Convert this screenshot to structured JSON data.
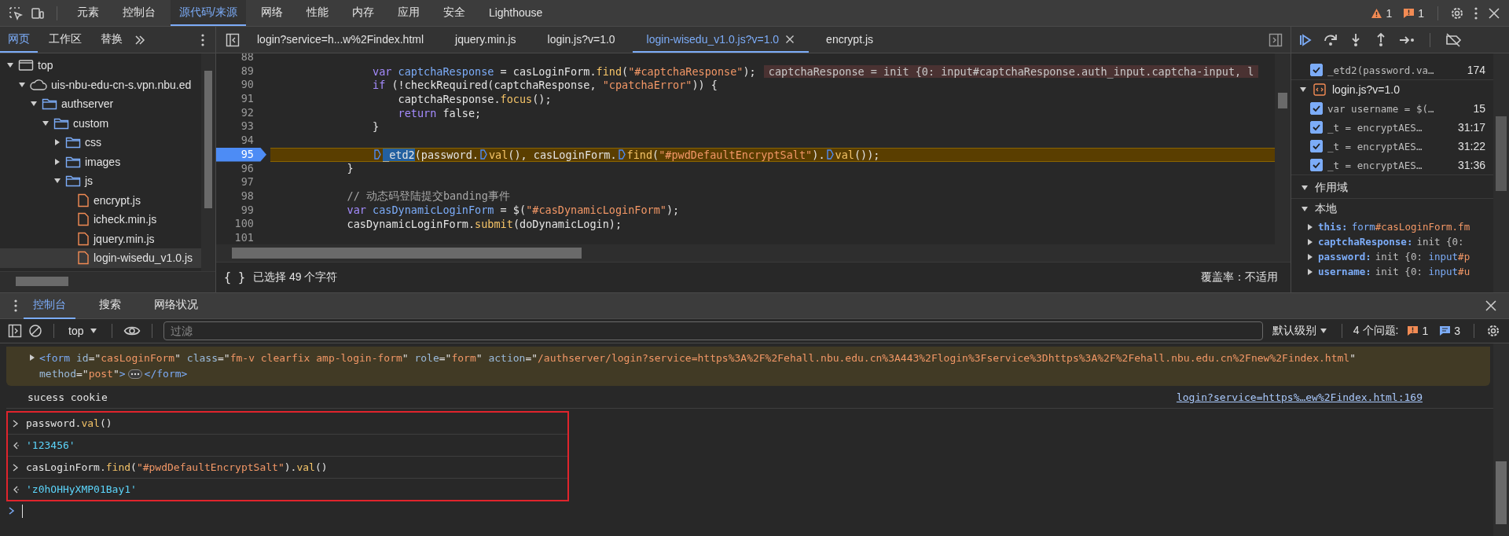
{
  "toolbar": {
    "tabs": [
      {
        "label": "元素",
        "selected": false
      },
      {
        "label": "控制台",
        "selected": false
      },
      {
        "label": "源代码/来源",
        "selected": true
      },
      {
        "label": "网络",
        "selected": false
      },
      {
        "label": "性能",
        "selected": false
      },
      {
        "label": "内存",
        "selected": false
      },
      {
        "label": "应用",
        "selected": false
      },
      {
        "label": "安全",
        "selected": false
      },
      {
        "label": "Lighthouse",
        "selected": false
      }
    ],
    "warnings": "1",
    "issues": "1"
  },
  "navigator": {
    "tabs": [
      {
        "label": "网页",
        "selected": true
      },
      {
        "label": "工作区",
        "selected": false
      },
      {
        "label": "替换",
        "selected": false
      }
    ],
    "tree": [
      {
        "label": "top",
        "kind": "frame",
        "expanded": true,
        "selected": false,
        "children": [
          {
            "label": "uis-nbu-edu-cn-s.vpn.nbu.ed",
            "kind": "domain",
            "expanded": true,
            "selected": false,
            "children": [
              {
                "label": "authserver",
                "kind": "folder",
                "expanded": true,
                "selected": false,
                "children": [
                  {
                    "label": "custom",
                    "kind": "folder",
                    "expanded": true,
                    "selected": false,
                    "children": [
                      {
                        "label": "css",
                        "kind": "folder",
                        "expanded": false,
                        "selected": false
                      },
                      {
                        "label": "images",
                        "kind": "folder",
                        "expanded": false,
                        "selected": false
                      },
                      {
                        "label": "js",
                        "kind": "folder",
                        "expanded": true,
                        "selected": false,
                        "children": [
                          {
                            "label": "encrypt.js",
                            "kind": "file",
                            "selected": false
                          },
                          {
                            "label": "icheck.min.js",
                            "kind": "file",
                            "selected": false
                          },
                          {
                            "label": "jquery.min.js",
                            "kind": "file",
                            "selected": false
                          },
                          {
                            "label": "login-wisedu_v1.0.js",
                            "kind": "file",
                            "selected": true
                          }
                        ]
                      }
                    ]
                  }
                ]
              }
            ]
          }
        ]
      }
    ]
  },
  "editor": {
    "tabs": [
      {
        "label": "login?service=h...w%2Findex.html",
        "selected": false
      },
      {
        "label": "jquery.min.js",
        "selected": false
      },
      {
        "label": "login.js?v=1.0",
        "selected": false
      },
      {
        "label": "login-wisedu_v1.0.js?v=1.0",
        "selected": true
      },
      {
        "label": "encrypt.js",
        "selected": false
      }
    ],
    "lines": [
      {
        "number": "88",
        "paused": false
      },
      {
        "number": "89",
        "paused": false,
        "tokens": [
          {
            "text": "var ",
            "kind": "keyword"
          },
          {
            "text": "captchaResponse",
            "kind": "def"
          },
          {
            "text": " = casLoginForm.",
            "kind": "plain"
          },
          {
            "text": "find",
            "kind": "method"
          },
          {
            "text": "(",
            "kind": "plain"
          },
          {
            "text": "\"#captchaResponse\"",
            "kind": "string"
          },
          {
            "text": ");",
            "kind": "plain"
          }
        ],
        "inline_value": "captchaResponse = init {0: input#captchaResponse.auth_input.captcha-input, l"
      },
      {
        "number": "90",
        "paused": false,
        "tokens": [
          {
            "text": "if",
            "kind": "keyword"
          },
          {
            "text": " (!checkRequired(captchaResponse, ",
            "kind": "plain"
          },
          {
            "text": "\"cpatchaError\"",
            "kind": "string"
          },
          {
            "text": ")) {",
            "kind": "plain"
          }
        ]
      },
      {
        "number": "91",
        "paused": false,
        "tokens": [
          {
            "text": "captchaResponse.",
            "kind": "plain"
          },
          {
            "text": "focus",
            "kind": "method"
          },
          {
            "text": "();",
            "kind": "plain"
          }
        ]
      },
      {
        "number": "92",
        "paused": false,
        "tokens": [
          {
            "text": "return",
            "kind": "keyword"
          },
          {
            "text": " false;",
            "kind": "plain"
          }
        ]
      },
      {
        "number": "93",
        "paused": false,
        "tokens": [
          {
            "text": "}",
            "kind": "plain"
          }
        ]
      },
      {
        "number": "94",
        "paused": false
      },
      {
        "number": "95",
        "paused": true,
        "tokens": [
          {
            "kind": "marker"
          },
          {
            "text": "_etd2",
            "kind": "selection"
          },
          {
            "text": "(password.",
            "kind": "plain"
          },
          {
            "kind": "marker"
          },
          {
            "text": "val",
            "kind": "method"
          },
          {
            "text": "(), casLoginForm.",
            "kind": "plain"
          },
          {
            "kind": "marker"
          },
          {
            "text": "find",
            "kind": "method"
          },
          {
            "text": "(",
            "kind": "plain"
          },
          {
            "text": "\"#pwdDefaultEncryptSalt\"",
            "kind": "string"
          },
          {
            "text": ").",
            "kind": "plain"
          },
          {
            "kind": "marker"
          },
          {
            "text": "val",
            "kind": "method"
          },
          {
            "text": "());",
            "kind": "plain"
          }
        ]
      },
      {
        "number": "96",
        "paused": false,
        "tokens": [
          {
            "text": "}",
            "kind": "plain"
          }
        ]
      },
      {
        "number": "97",
        "paused": false
      },
      {
        "number": "98",
        "paused": false,
        "tokens": [
          {
            "text": "// 动态码登陆提交banding事件",
            "kind": "comment"
          }
        ]
      },
      {
        "number": "99",
        "paused": false,
        "tokens": [
          {
            "text": "var ",
            "kind": "keyword"
          },
          {
            "text": "casDynamicLoginForm",
            "kind": "def"
          },
          {
            "text": " = $(",
            "kind": "plain"
          },
          {
            "text": "\"#casDynamicLoginForm\"",
            "kind": "string"
          },
          {
            "text": ");",
            "kind": "plain"
          }
        ]
      },
      {
        "number": "100",
        "paused": false,
        "tokens": [
          {
            "text": "casDynamicLoginForm.",
            "kind": "plain"
          },
          {
            "text": "submit",
            "kind": "method"
          },
          {
            "text": "(doDynamicLogin);",
            "kind": "plain"
          }
        ]
      },
      {
        "number": "101",
        "paused": false
      }
    ],
    "status": {
      "format_button": "{ }",
      "selection": "已选择 49 个字符",
      "coverage": "覆盖率：不适用"
    }
  },
  "debugger": {
    "breakpoint_groups": [
      {
        "breakpoints": [
          {
            "code": "_etd2(password.va…",
            "line": "174",
            "checked": true
          }
        ]
      },
      {
        "file": "login.js?v=1.0",
        "expanded": true,
        "breakpoints": [
          {
            "code": "var username = $(…",
            "line": "15",
            "checked": true
          },
          {
            "code": "_t = encryptAES…",
            "line": "31:17",
            "checked": true
          },
          {
            "code": "_t = encryptAES…",
            "line": "31:22",
            "checked": true
          },
          {
            "code": "_t = encryptAES…",
            "line": "31:36",
            "checked": true
          }
        ]
      }
    ],
    "scope": {
      "title": "作用域",
      "expanded": true,
      "sections": [
        {
          "title": "本地",
          "expanded": true,
          "variables": [
            {
              "name": "this:",
              "tokens": [
                {
                  "text": "form",
                  "kind": "def"
                },
                {
                  "text": "#casLoginForm.fm",
                  "kind": "string"
                }
              ]
            },
            {
              "name": "captchaResponse:",
              "tokens": [
                {
                  "text": "init {0:",
                  "kind": "dim"
                }
              ]
            },
            {
              "name": "password:",
              "tokens": [
                {
                  "text": "init {0: ",
                  "kind": "dim"
                },
                {
                  "text": "input",
                  "kind": "def"
                },
                {
                  "text": "#p",
                  "kind": "string"
                }
              ]
            },
            {
              "name": "username:",
              "tokens": [
                {
                  "text": "init {0: ",
                  "kind": "dim"
                },
                {
                  "text": "input",
                  "kind": "def"
                },
                {
                  "text": "#u",
                  "kind": "string"
                }
              ]
            }
          ]
        }
      ]
    }
  },
  "drawer": {
    "tabs": [
      {
        "label": "控制台",
        "selected": true
      },
      {
        "label": "搜索",
        "selected": false
      },
      {
        "label": "网络状况",
        "selected": false
      }
    ],
    "context": "top",
    "filter": {
      "placeholder": "过滤"
    },
    "level": "默认级别",
    "issues": {
      "label": "4 个问题:",
      "errors": "1",
      "infos": "3"
    },
    "messages": [
      {
        "kind": "element",
        "expanded": false,
        "lines": [
          {
            "tokens": [
              {
                "text": "<form",
                "kind": "tag"
              },
              {
                "text": " id",
                "kind": "attr"
              },
              {
                "text": "=\"",
                "kind": "plain"
              },
              {
                "text": "casLoginForm",
                "kind": "value"
              },
              {
                "text": "\" ",
                "kind": "plain"
              },
              {
                "text": "class",
                "kind": "attr"
              },
              {
                "text": "=\"",
                "kind": "plain"
              },
              {
                "text": "fm-v clearfix amp-login-form",
                "kind": "value"
              },
              {
                "text": "\" ",
                "kind": "plain"
              },
              {
                "text": "role",
                "kind": "attr"
              },
              {
                "text": "=\"",
                "kind": "plain"
              },
              {
                "text": "form",
                "kind": "value"
              },
              {
                "text": "\" ",
                "kind": "plain"
              },
              {
                "text": "action",
                "kind": "attr"
              },
              {
                "text": "=\"",
                "kind": "plain"
              },
              {
                "text": "/authserver/login?service=https%3A%2F%2Fehall.nbu.edu.cn%3A443%2Flogin%3Fservice%3Dhttps%3A%2F%2Fehall.nbu.edu.cn%2Fnew%2Findex.html",
                "kind": "value"
              },
              {
                "text": "\"",
                "kind": "plain"
              }
            ]
          },
          {
            "tokens": [
              {
                "text": "method",
                "kind": "attr"
              },
              {
                "text": "=\"",
                "kind": "plain"
              },
              {
                "text": "post",
                "kind": "value"
              },
              {
                "text": "\"",
                "kind": "plain"
              },
              {
                "text": ">",
                "kind": "tag"
              },
              {
                "kind": "ellipsis"
              },
              {
                "text": "</form>",
                "kind": "tag"
              }
            ]
          }
        ]
      },
      {
        "kind": "log",
        "text": "sucess cookie",
        "source": "login?service=https%…ew%2Findex.html:169"
      }
    ],
    "highlighted": [
      {
        "kind": "input",
        "tokens": [
          {
            "text": "password.",
            "kind": "plain"
          },
          {
            "text": "val",
            "kind": "method"
          },
          {
            "text": "()",
            "kind": "plain"
          }
        ]
      },
      {
        "kind": "result",
        "text": "'123456'"
      },
      {
        "kind": "input",
        "tokens": [
          {
            "text": "casLoginForm.",
            "kind": "plain"
          },
          {
            "text": "find",
            "kind": "method"
          },
          {
            "text": "(",
            "kind": "plain"
          },
          {
            "text": "\"#pwdDefaultEncryptSalt\"",
            "kind": "string"
          },
          {
            "text": ").",
            "kind": "plain"
          },
          {
            "text": "val",
            "kind": "method"
          },
          {
            "text": "()",
            "kind": "plain"
          }
        ]
      },
      {
        "kind": "result",
        "text": "'z0hOHHyXMP01Bay1'"
      }
    ]
  }
}
